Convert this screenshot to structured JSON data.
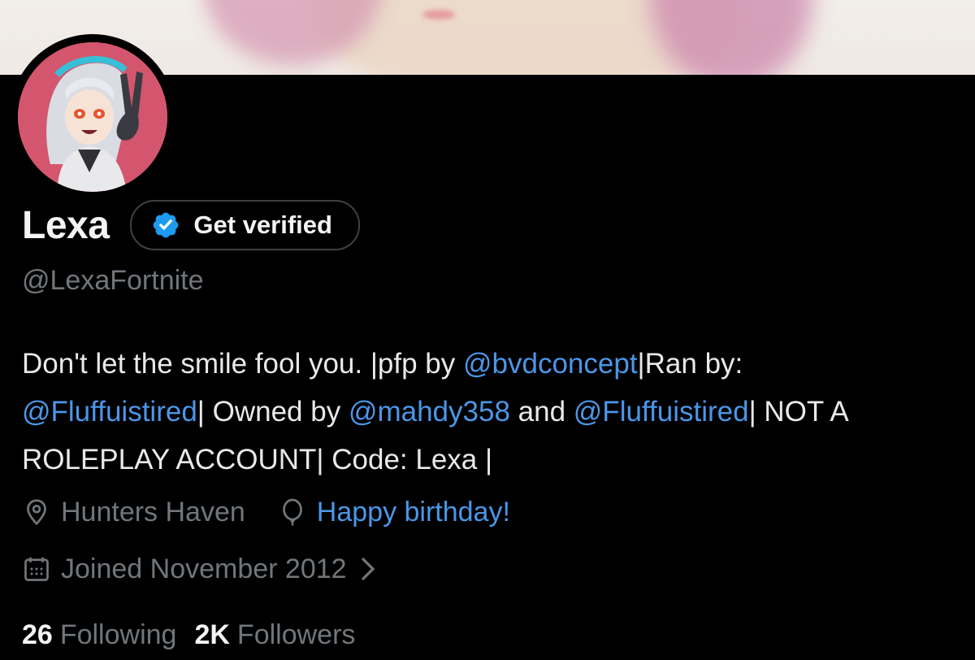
{
  "profile": {
    "display_name": "Lexa",
    "handle": "@LexaFortnite",
    "verify_label": "Get verified"
  },
  "bio": {
    "segments": [
      {
        "text": "Don't let the smile fool you. |pfp by ",
        "type": "text"
      },
      {
        "text": "@bvdconcept",
        "type": "mention"
      },
      {
        "text": "|Ran by: ",
        "type": "text"
      },
      {
        "text": "@Fluffuistired",
        "type": "mention"
      },
      {
        "text": "| Owned by ",
        "type": "text"
      },
      {
        "text": "@mahdy358",
        "type": "mention"
      },
      {
        "text": " and ",
        "type": "text"
      },
      {
        "text": "@Fluffuistired",
        "type": "mention"
      },
      {
        "text": "| NOT A ROLEPLAY ACCOUNT| Code: Lexa |",
        "type": "text"
      }
    ]
  },
  "meta": {
    "location": "Hunters Haven",
    "birthday": "Happy birthday!",
    "joined": "Joined November 2012"
  },
  "stats": {
    "following_count": "26",
    "following_label": "Following",
    "followers_count": "2K",
    "followers_label": "Followers"
  },
  "icons": {
    "verified_badge": "verified-badge-icon",
    "location": "location-pin-icon",
    "birthday": "balloon-icon",
    "joined": "calendar-icon",
    "chevron": "chevron-right-icon"
  },
  "colors": {
    "background": "#000000",
    "primary_text": "#e7e9ea",
    "secondary_text": "#71767b",
    "link": "#4c96e8",
    "verified_blue": "#1d9bf0",
    "avatar_ring": "#d4566e"
  }
}
